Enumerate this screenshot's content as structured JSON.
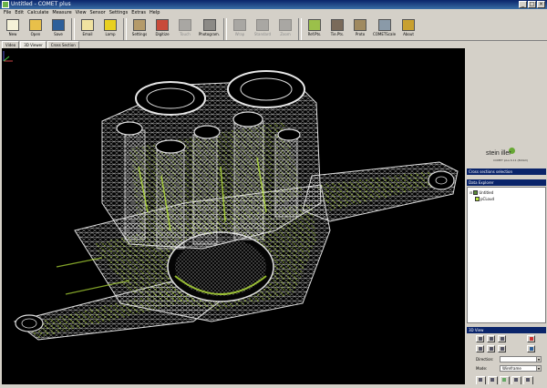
{
  "window": {
    "title": "Untitled - COMET plus"
  },
  "menu": [
    "File",
    "Edit",
    "Calculate",
    "Measure",
    "View",
    "Sensor",
    "Settings",
    "Extras",
    "Help"
  ],
  "toolbar": [
    {
      "label": "New",
      "icon": "new-icon",
      "color": "#f5f1d8",
      "enabled": true
    },
    {
      "label": "Open",
      "icon": "open-icon",
      "color": "#e8c04a",
      "enabled": true
    },
    {
      "label": "Save",
      "icon": "save-icon",
      "color": "#2d5f9a",
      "enabled": true
    },
    {
      "sep": true
    },
    {
      "label": "Email",
      "icon": "email-icon",
      "color": "#f0e2a0",
      "enabled": true
    },
    {
      "label": "Lamp",
      "icon": "lamp-icon",
      "color": "#e8d020",
      "enabled": true
    },
    {
      "sep": true
    },
    {
      "label": "Settings",
      "icon": "settings-icon",
      "color": "#b49a6a",
      "enabled": true
    },
    {
      "label": "Digitize",
      "icon": "digitize-icon",
      "color": "#c84a3a",
      "enabled": true
    },
    {
      "label": "Touch",
      "icon": "touch-icon",
      "color": "#a9a7a3",
      "enabled": false
    },
    {
      "label": "Photogram.",
      "icon": "photogrammetry-icon",
      "color": "#8c8a86",
      "enabled": true
    },
    {
      "sep": true
    },
    {
      "label": "Wrap",
      "icon": "wrap-icon",
      "color": "#a9a7a3",
      "enabled": false
    },
    {
      "label": "Standard",
      "icon": "standard-icon",
      "color": "#a9a7a3",
      "enabled": false
    },
    {
      "label": "Zoom",
      "icon": "zoom-icon",
      "color": "#a9a7a3",
      "enabled": false
    },
    {
      "sep": true
    },
    {
      "label": "Ref.Pts.",
      "icon": "reference-points-icon",
      "color": "#9bc04a",
      "enabled": true
    },
    {
      "label": "Tie.Pts.",
      "icon": "tie-points-icon",
      "color": "#7a6a5a",
      "enabled": true
    },
    {
      "label": "Proto",
      "icon": "protocol-icon",
      "color": "#a08a60",
      "enabled": true
    },
    {
      "label": "COMETScale",
      "icon": "comet-scale-icon",
      "color": "#8a9aa8",
      "enabled": true
    },
    {
      "label": "About",
      "icon": "about-icon",
      "color": "#c8a030",
      "enabled": true
    }
  ],
  "tabs": [
    {
      "label": "Video",
      "active": false
    },
    {
      "label": "3D Viewer",
      "active": true
    },
    {
      "label": "Cross Section",
      "active": false
    }
  ],
  "right_panel": {
    "logo_text": "stein iller",
    "logo_sub": "COMET plus 6.11 (BUILD)",
    "cross_section_header": "Cross sections selection",
    "explorer_header": "Data Explorer",
    "tree": [
      {
        "label": "Untitled",
        "level": 0
      },
      {
        "label": "pCLoud",
        "level": 1
      }
    ],
    "view3d_header": "3D View",
    "direction_label": "Direction:",
    "direction_value": "",
    "mode_label": "Mode:",
    "mode_value": "Wireframe"
  },
  "colors": {
    "viewport_bg": "#000000",
    "mesh": "#d8d8d8",
    "point_cloud": "#b8e63a",
    "title_active": "#0a246a"
  }
}
